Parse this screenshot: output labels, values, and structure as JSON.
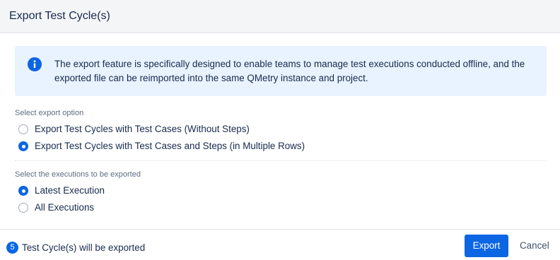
{
  "dialog": {
    "title": "Export Test Cycle(s)"
  },
  "info": {
    "icon": "info-icon",
    "text": "The export feature is specifically designed to enable teams to manage test executions conducted offline, and the exported file can be reimported into the same QMetry instance and project."
  },
  "export_option": {
    "label": "Select export option",
    "options": [
      {
        "label": "Export Test Cycles with Test Cases (Without Steps)",
        "checked": false
      },
      {
        "label": "Export Test Cycles with Test Cases and Steps (in Multiple Rows)",
        "checked": true
      }
    ]
  },
  "executions": {
    "label": "Select the executions to be exported",
    "options": [
      {
        "label": "Latest Execution",
        "checked": true
      },
      {
        "label": "All Executions",
        "checked": false
      }
    ]
  },
  "footer": {
    "count": "5",
    "count_text": "Test Cycle(s) will be exported",
    "export_label": "Export",
    "cancel_label": "Cancel"
  },
  "colors": {
    "accent": "#0c66e4",
    "info_background": "#e9f2ff",
    "header_background": "#f4f5f7"
  }
}
